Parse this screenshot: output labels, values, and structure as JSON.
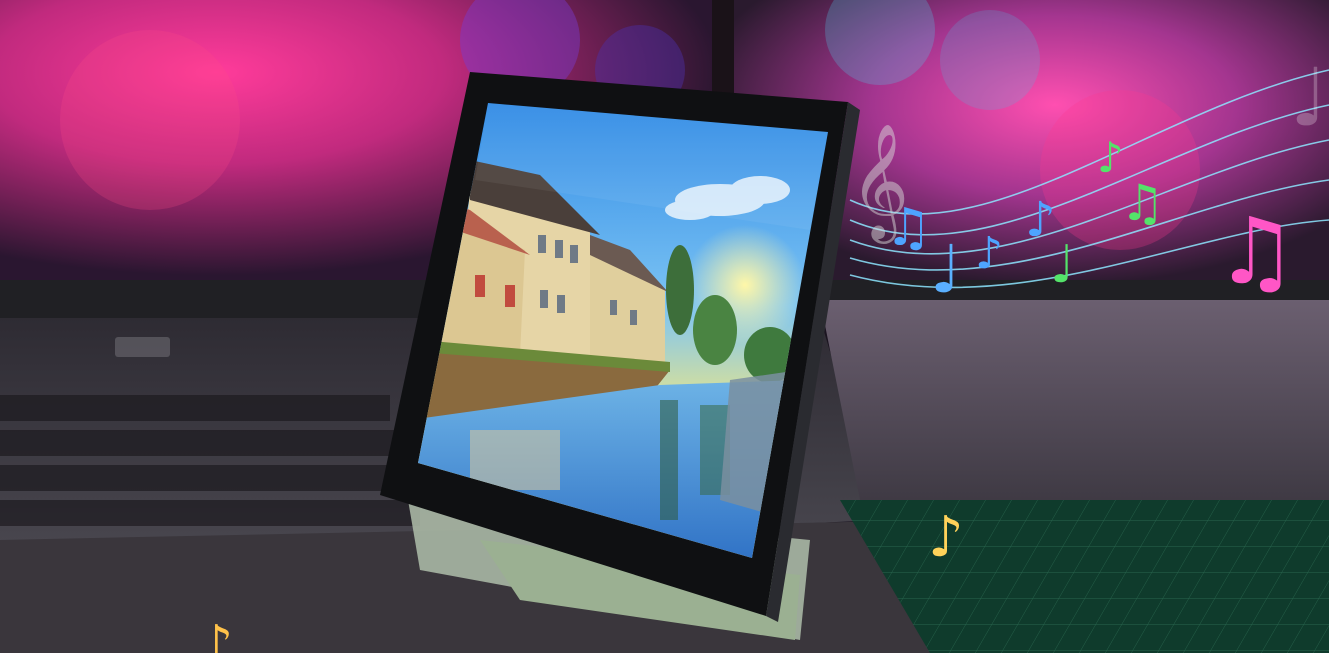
{
  "scene": {
    "description_label": "",
    "colors": {
      "bg_magenta": "#e0308a",
      "bg_purple": "#6a2bb0",
      "bg_dark": "#171219",
      "laptop_gray": "#3a3a40",
      "desk_green": "#0f3b2c",
      "bezel": "#111214",
      "stand": "#a9b7a4",
      "sky_top": "#2f8fe8",
      "sky_mid": "#8fd0f7",
      "sun_glow": "#f7ea78",
      "water": "#3f8fd8",
      "wall_cream": "#e9d8a9",
      "roof_red": "#b9614e",
      "tree_green": "#3f7a3e",
      "note_blue": "#4ea4ff",
      "note_green": "#54e36a",
      "note_pink": "#ff56c6",
      "note_gold": "#ffd25a",
      "staff_line": "#8ee7ff"
    },
    "notes": [
      {
        "name": "blue-beamed-note-icon"
      },
      {
        "name": "blue-eighth-note-icon"
      },
      {
        "name": "blue-small-note-icon"
      },
      {
        "name": "blue-high-note-icon"
      },
      {
        "name": "green-eighth-note-icon"
      },
      {
        "name": "green-beamed-note-icon"
      },
      {
        "name": "green-small-note-icon"
      },
      {
        "name": "pink-beamed-note-icon"
      },
      {
        "name": "gold-note-icon"
      },
      {
        "name": "gold-bottom-note-icon"
      },
      {
        "name": "treble-clef-icon"
      }
    ]
  }
}
